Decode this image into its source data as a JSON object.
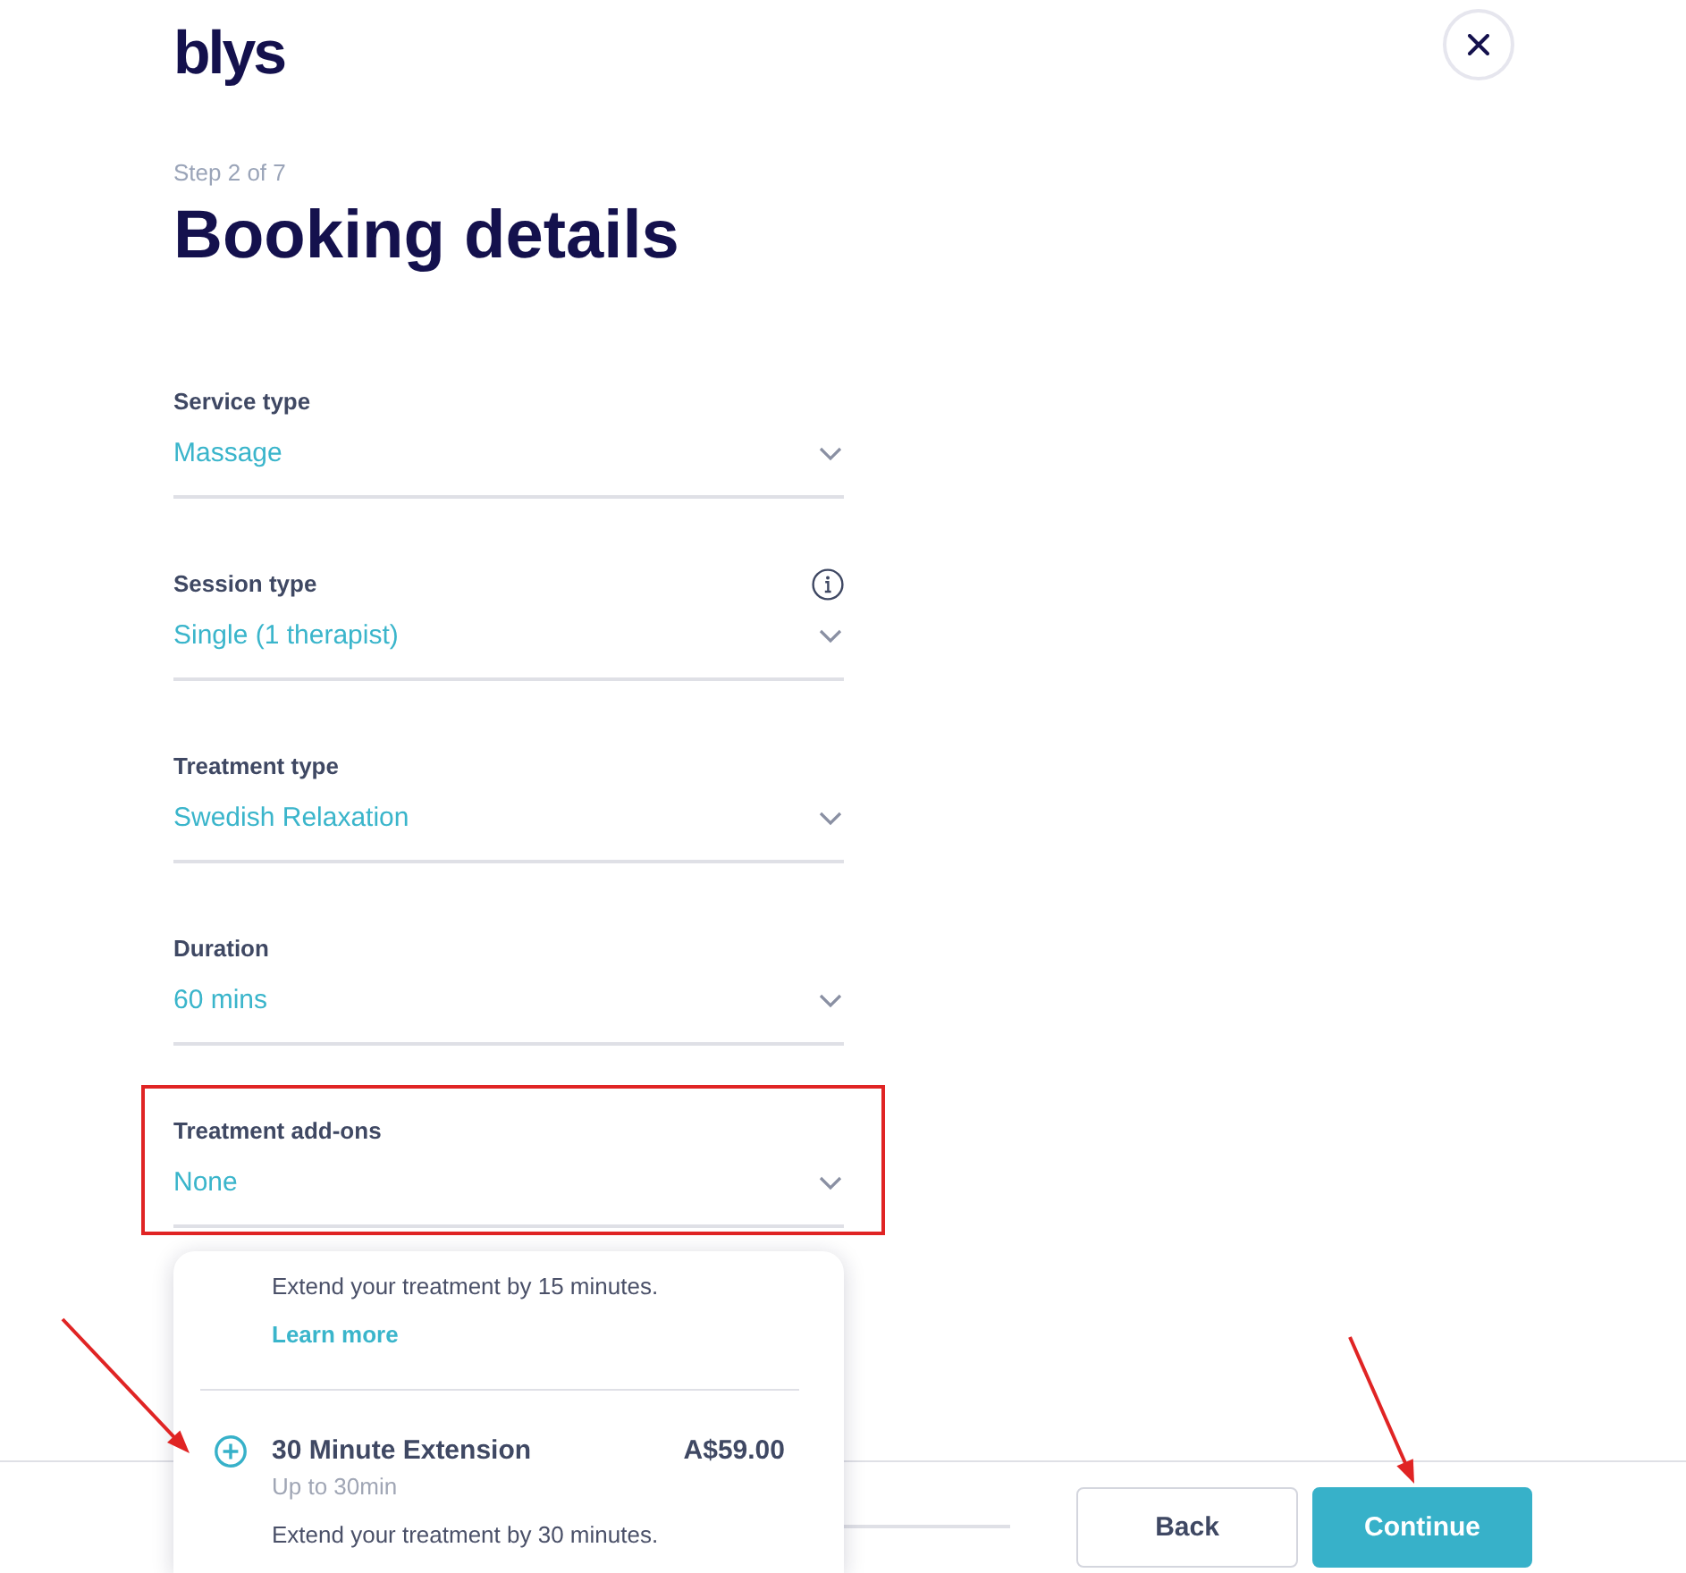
{
  "header": {
    "logo": "blys"
  },
  "step": "Step 2 of 7",
  "title": "Booking details",
  "fields": [
    {
      "label": "Service type",
      "value": "Massage",
      "info": false,
      "highlighted": false
    },
    {
      "label": "Session type",
      "value": "Single (1 therapist)",
      "info": true,
      "highlighted": false
    },
    {
      "label": "Treatment type",
      "value": "Swedish Relaxation",
      "info": false,
      "highlighted": false
    },
    {
      "label": "Duration",
      "value": "60 mins",
      "info": false,
      "highlighted": false
    },
    {
      "label": "Treatment add-ons",
      "value": "None",
      "info": false,
      "highlighted": true,
      "menu": {
        "items": [
          {
            "description": "Extend your treatment by 15 minutes.",
            "link": "Learn more"
          },
          {
            "title": "30 Minute Extension",
            "price": "A$59.00",
            "subtitle": "Up to 30min",
            "description": "Extend your treatment by 30 minutes."
          }
        ]
      }
    }
  ],
  "footer": {
    "buttons": [
      {
        "label": "Back",
        "kind": "secondary"
      },
      {
        "label": "Continue",
        "kind": "primary"
      }
    ]
  }
}
